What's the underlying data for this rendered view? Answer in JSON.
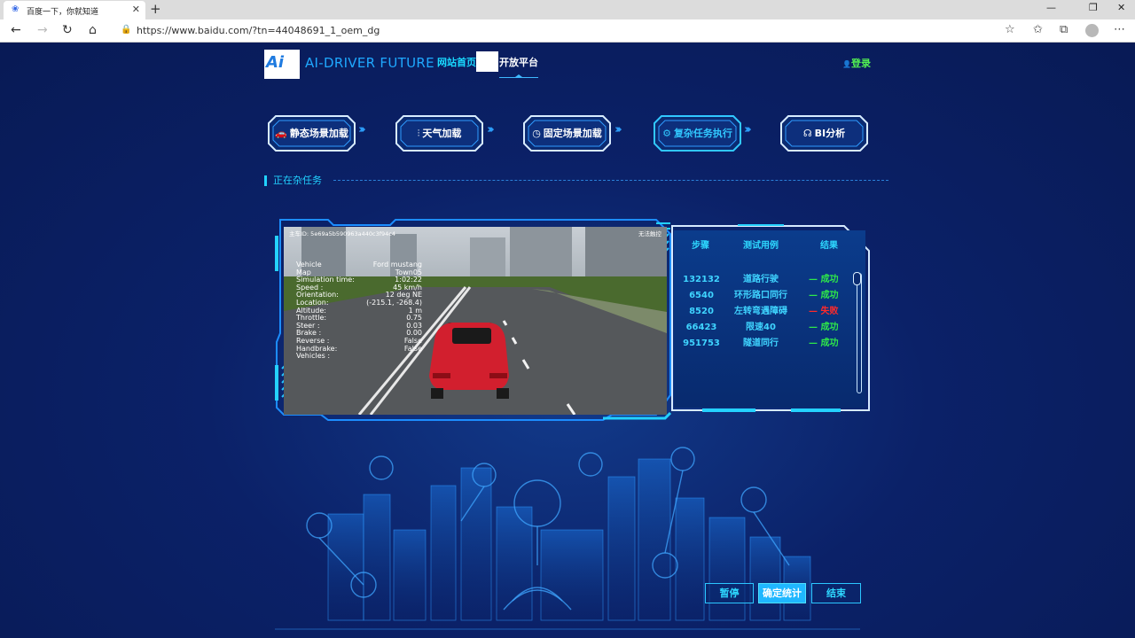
{
  "browser": {
    "tab_title": "百度一下，你就知道",
    "url": "https://www.baidu.com/?tn=44048691_1_oem_dg",
    "tab_close": "✕",
    "new_tab": "+",
    "minimize": "—",
    "restore": "❐",
    "close": "✕",
    "back": "←",
    "forward": "→",
    "refresh": "↻",
    "home": "⌂",
    "star": "☆",
    "favorites": "✩",
    "collections": "⧉",
    "more": "⋯"
  },
  "header": {
    "logo_mark": "Ai",
    "logo_text": "AI-DRIVER FUTURE",
    "nav_home": "网站首页",
    "nav_open": "开放平台",
    "login": "登录",
    "login_icon": "👤"
  },
  "steps": [
    {
      "label": "静态场景加载",
      "icon": "car-icon",
      "glyph": "🚗"
    },
    {
      "label": "天气加载",
      "icon": "sliders-icon",
      "glyph": "⫶"
    },
    {
      "label": "固定场景加载",
      "icon": "clock-icon",
      "glyph": "◷"
    },
    {
      "label": "复杂任务执行",
      "icon": "gear-icon",
      "glyph": "⚙",
      "active": true
    },
    {
      "label": "BI分析",
      "icon": "steering-icon",
      "glyph": "☊"
    }
  ],
  "step_arrows": "››››",
  "section": {
    "title": "正在杂任务"
  },
  "video": {
    "vehicle_id": "主车ID: 5e69a5b590963a440c3f94c4",
    "top_right": "无法触控",
    "hud": [
      {
        "label": "Vehicle",
        "value": "Ford mustang"
      },
      {
        "label": "Map",
        "value": "Town05"
      },
      {
        "label": "Simulation time:",
        "value": "1:02:22"
      },
      {
        "label": "Speed :",
        "value": "45 km/h"
      },
      {
        "label": "Orientation:",
        "value": "12 deg NE"
      },
      {
        "label": "Location:",
        "value": "(-215.1, -268.4)"
      },
      {
        "label": "Altitude:",
        "value": "1 m"
      },
      {
        "label": "Throttle:",
        "value": "0.75"
      },
      {
        "label": "Steer :",
        "value": "0.03"
      },
      {
        "label": "Brake :",
        "value": "0.00"
      },
      {
        "label": "Reverse :",
        "value": "False"
      },
      {
        "label": "Handbrake:",
        "value": "False"
      },
      {
        "label": "Vehicles :",
        "value": ""
      }
    ]
  },
  "results": {
    "headers": [
      "步骤",
      "测试用例",
      "结果"
    ],
    "rows": [
      {
        "step": "132132",
        "case": "道路行驶",
        "result": "— 成功",
        "ok": true
      },
      {
        "step": "6540",
        "case": "环形路口同行",
        "result": "— 成功",
        "ok": true
      },
      {
        "step": "8520",
        "case": "左转弯遇障碍",
        "result": "— 失败",
        "ok": false
      },
      {
        "step": "66423",
        "case": "限速40",
        "result": "— 成功",
        "ok": true
      },
      {
        "step": "951753",
        "case": "隧道同行",
        "result": "— 成功",
        "ok": true
      }
    ],
    "success_color": "#2ee84a",
    "fail_color": "#ff2a2a"
  },
  "buttons": {
    "pause": "暂停",
    "confirm": "确定统计",
    "end": "结束"
  }
}
